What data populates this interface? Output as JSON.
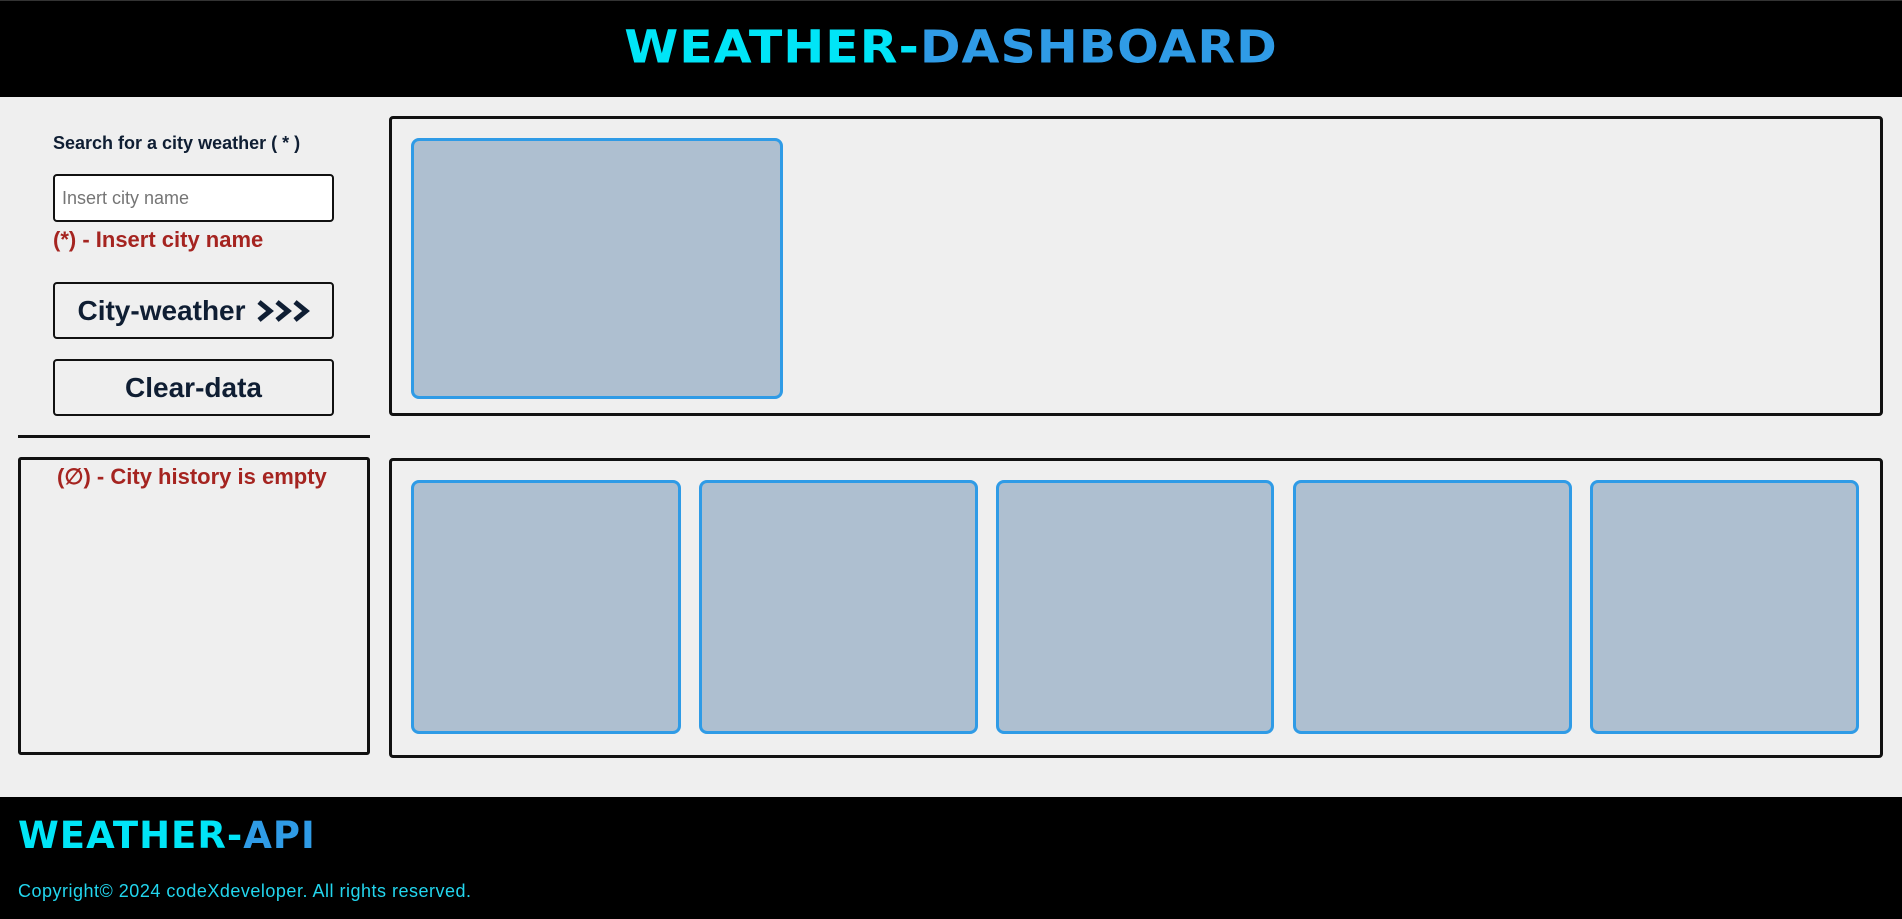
{
  "header": {
    "title_part1": "WEATHER-",
    "title_part2": "DASHBOARD"
  },
  "search": {
    "label": "Search for a city weather ( * )",
    "placeholder": "Insert city name",
    "value": "",
    "hint": "(*) - Insert city name",
    "search_button_label": "City-weather",
    "search_button_icon": "triple-chevron-right-icon",
    "clear_button_label": "Clear-data"
  },
  "history": {
    "empty_message": "(∅) - City history is empty"
  },
  "footer": {
    "brand_part1": "WEATHER-",
    "brand_part2": "API",
    "copyright": "Copyright© 2024 codeXdeveloper. All rights reserved."
  },
  "colors": {
    "accent_cyan": "#00e5f7",
    "accent_blue": "#2f9be6",
    "error_red": "#a52420",
    "card_fill": "#aebfd0",
    "background": "#efefef"
  }
}
